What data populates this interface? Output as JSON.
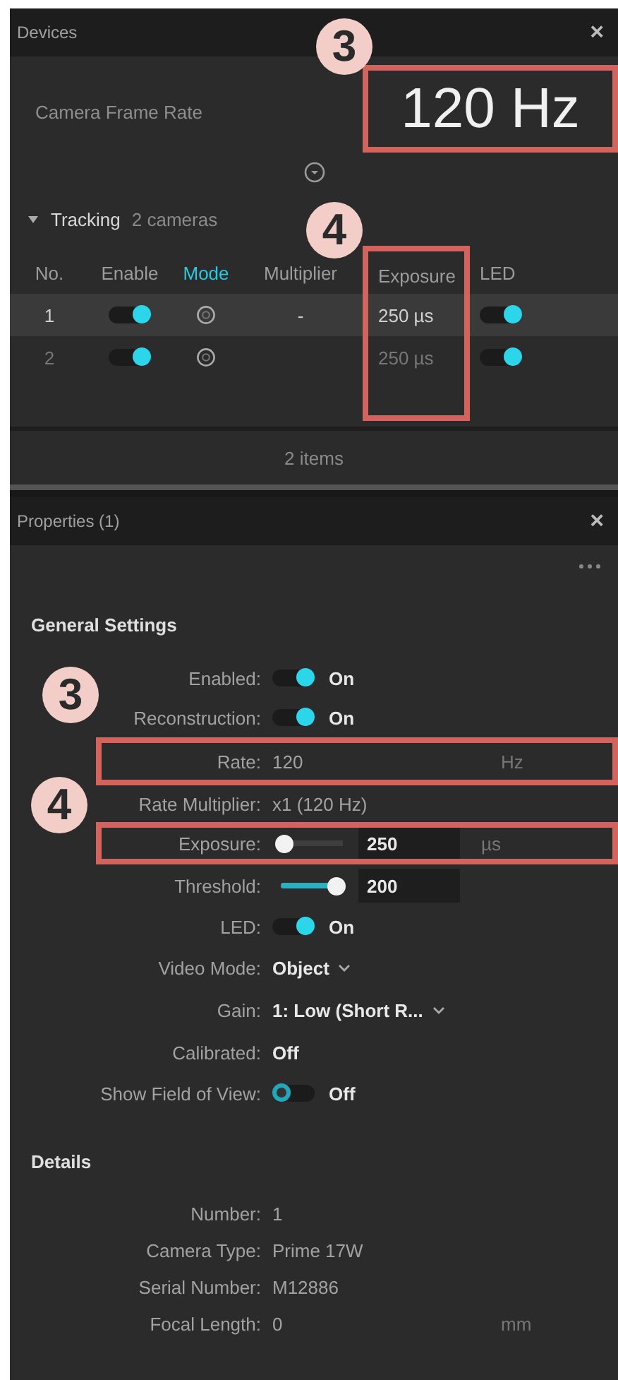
{
  "devices_panel": {
    "title": "Devices",
    "close": "×",
    "frame_rate": {
      "label": "Camera Frame Rate",
      "value": "120 Hz",
      "highlighted": true
    },
    "tracking": {
      "label": "Tracking",
      "count": "2 cameras",
      "expanded": true
    },
    "table": {
      "columns": [
        {
          "label": "No.",
          "selected": false,
          "highlighted": false
        },
        {
          "label": "Enable",
          "selected": false,
          "highlighted": false
        },
        {
          "label": "Mode",
          "selected": true,
          "highlighted": false
        },
        {
          "label": "Multiplier",
          "selected": false,
          "highlighted": false
        },
        {
          "label": "Exposure",
          "selected": false,
          "highlighted": true
        },
        {
          "label": "LED",
          "selected": false,
          "highlighted": false
        }
      ],
      "rows": [
        {
          "no": "1",
          "enabled": true,
          "multiplier": "-",
          "exposure": "250 µs",
          "led": true,
          "selected": true
        },
        {
          "no": "2",
          "enabled": true,
          "exposure": "250 µs",
          "led": true,
          "selected": false
        }
      ]
    },
    "footer": "2 items"
  },
  "properties_panel": {
    "title": "Properties (1)",
    "close": "×",
    "sections": [
      {
        "title": "General Settings",
        "rows": [
          {
            "kind": "toggle",
            "label": "Enabled:",
            "on": true,
            "value": "On"
          },
          {
            "kind": "toggle",
            "label": "Reconstruction:",
            "on": true,
            "value": "On"
          },
          {
            "kind": "field",
            "label": "Rate:",
            "value": "120",
            "unit": "Hz",
            "highlighted": true
          },
          {
            "kind": "info",
            "label": "Rate Multiplier:",
            "value": "x1 (120 Hz)"
          },
          {
            "kind": "slider",
            "label": "Exposure:",
            "level": 0.05,
            "value": "250",
            "unit": "µs",
            "highlighted": true
          },
          {
            "kind": "slider",
            "label": "Threshold:",
            "level": 0.9,
            "value": "200"
          },
          {
            "kind": "toggle",
            "label": "LED:",
            "on": true,
            "value": "On"
          },
          {
            "kind": "dropdown",
            "label": "Video Mode:",
            "value": "Object"
          },
          {
            "kind": "dropdown",
            "label": "Gain:",
            "value": "1: Low (Short R..."
          },
          {
            "kind": "value",
            "label": "Calibrated:",
            "value": "Off"
          },
          {
            "kind": "toggle",
            "label": "Show Field of View:",
            "on": false,
            "value": "Off"
          }
        ]
      },
      {
        "title": "Details",
        "rows": [
          {
            "kind": "info",
            "label": "Number:",
            "value": "1"
          },
          {
            "kind": "info",
            "label": "Camera Type:",
            "value": "Prime 17W"
          },
          {
            "kind": "info",
            "label": "Serial Number:",
            "value": "M12886"
          },
          {
            "kind": "info",
            "label": "Focal Length:",
            "value": "0",
            "unit": "mm"
          }
        ]
      }
    ]
  },
  "callouts": [
    "3",
    "4",
    "3",
    "4"
  ]
}
